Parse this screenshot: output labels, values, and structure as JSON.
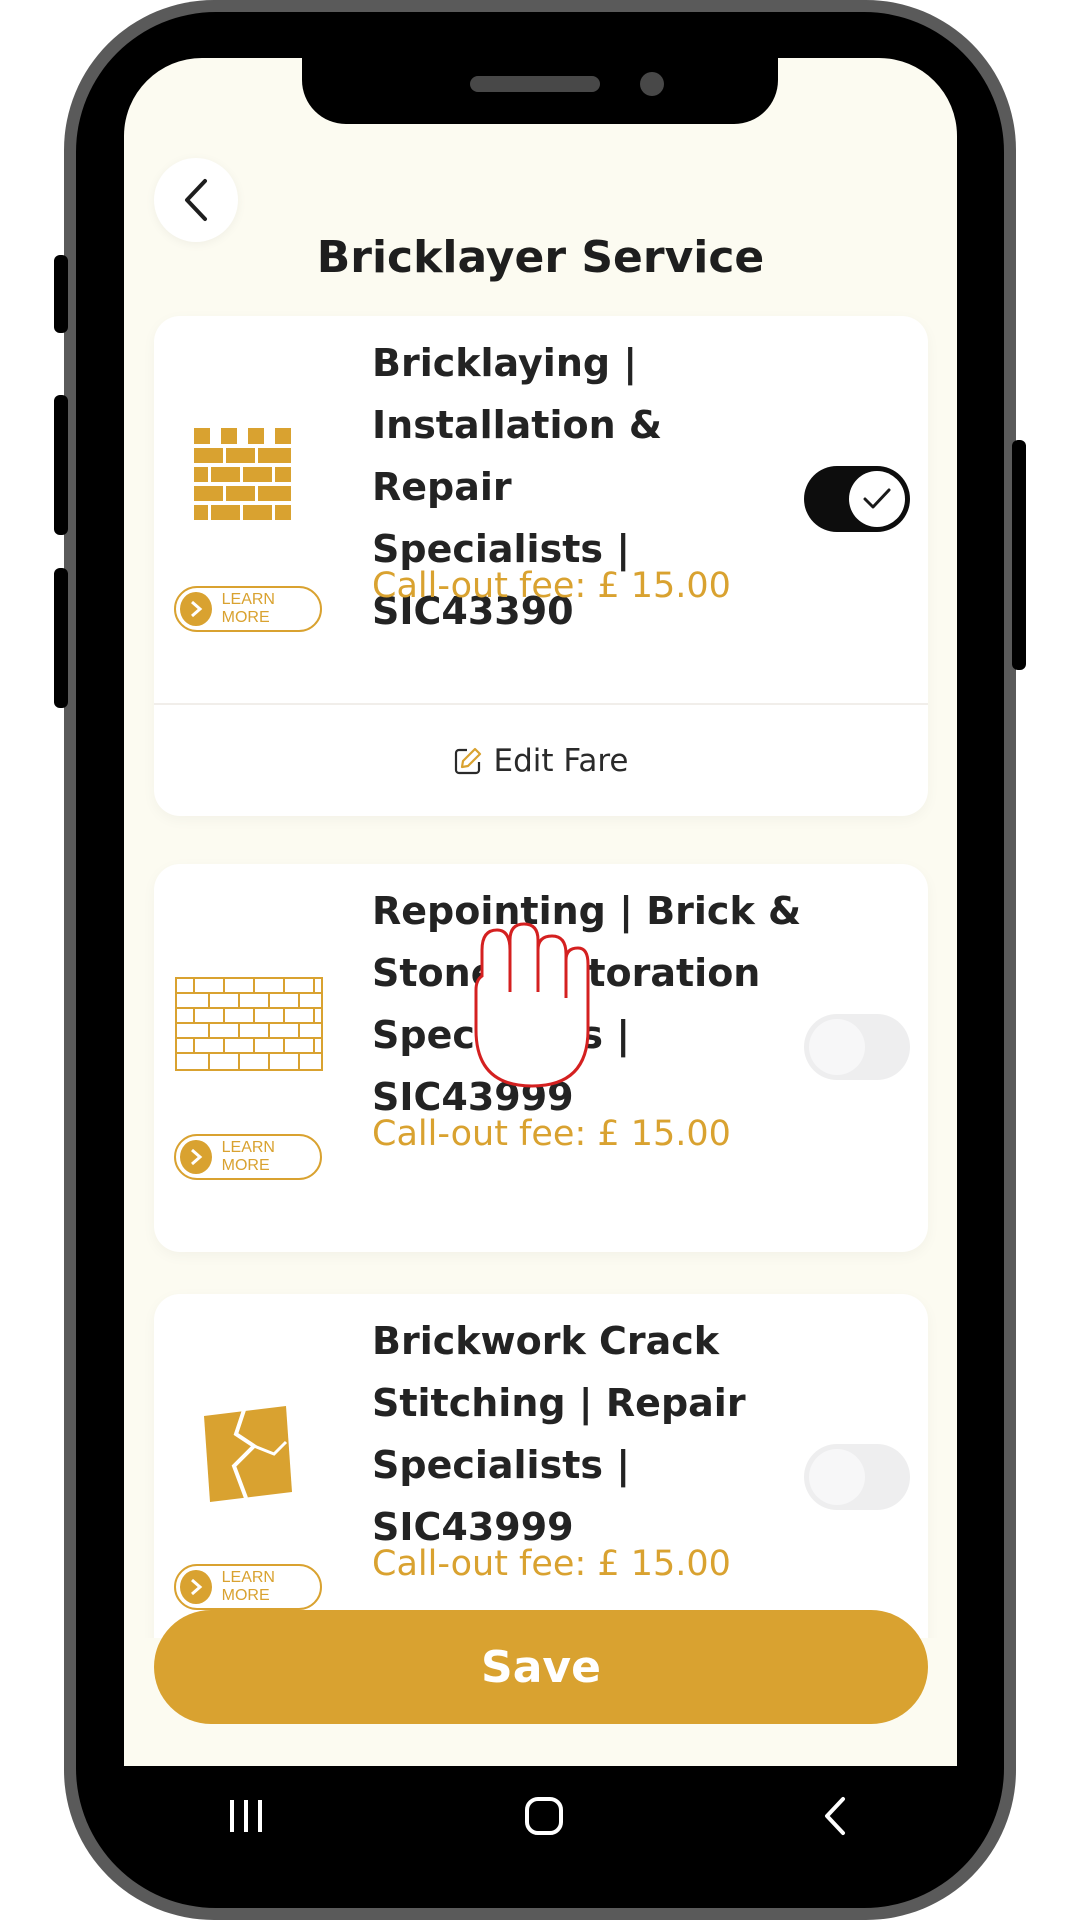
{
  "header": {
    "title": "Bricklayer Service",
    "back_icon": "chevron-left-icon"
  },
  "services": [
    {
      "name": "Bricklaying |\nInstallation & Repair\nSpecialists |\nSIC43390",
      "fee": "Call-out fee: £ 15.00",
      "learn_more": "LEARN MORE",
      "enabled": true,
      "edit_label": "Edit Fare",
      "image_icon": "brick-wall-icon"
    },
    {
      "name": "Repointing | Brick &\nStone Restoration\nSpecialists |\nSIC43999",
      "fee": "Call-out fee: £ 15.00",
      "learn_more": "LEARN MORE",
      "enabled": false,
      "image_icon": "brick-pattern-icon"
    },
    {
      "name": "Brickwork Crack\nStitching | Repair\nSpecialists |\nSIC43999",
      "fee": "Call-out fee: £ 15.00",
      "learn_more": "LEARN MORE",
      "enabled": false,
      "image_icon": "cracked-wall-icon"
    }
  ],
  "footer": {
    "save_label": "Save"
  },
  "colors": {
    "accent": "#d9a230",
    "background": "#fcfbf1",
    "toggle_on": "#0d0d0d",
    "toggle_off": "#eeeeef"
  },
  "nav": {
    "recent_icon": "recent-apps-icon",
    "home_icon": "home-icon",
    "back_icon": "nav-back-icon"
  }
}
